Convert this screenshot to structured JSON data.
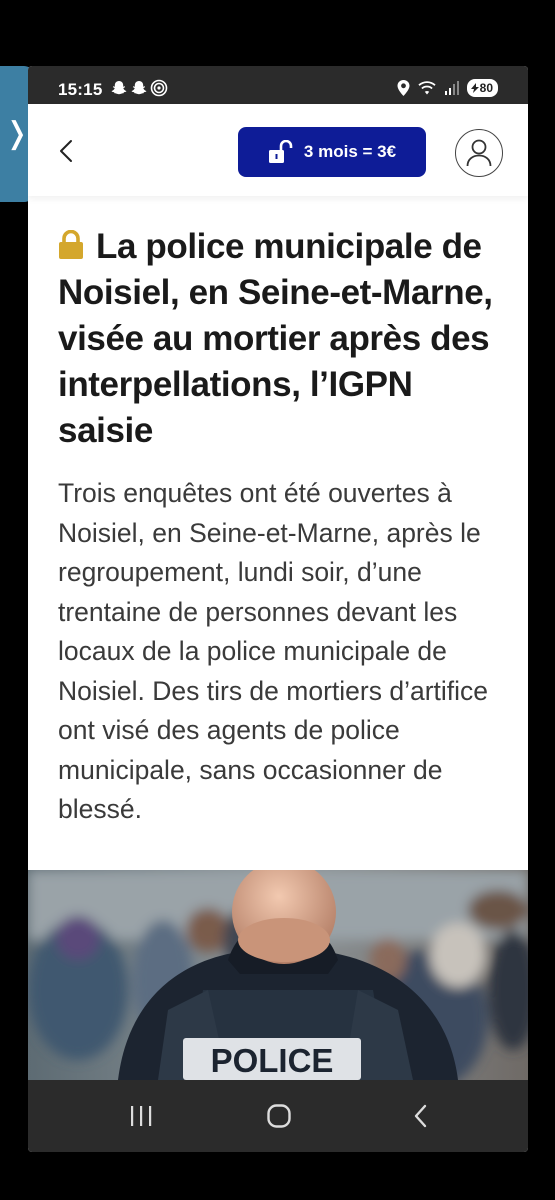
{
  "status_bar": {
    "time": "15:15",
    "notification_icons": [
      "snapchat-icon",
      "snapchat-icon",
      "signal-wifi-icon"
    ],
    "right_icons": [
      "location-icon",
      "wifi-icon",
      "signal-icon"
    ],
    "battery": "80"
  },
  "app_bar": {
    "back_icon": "chevron-left-icon",
    "offer_label": "3 mois = 3€",
    "offer_icon": "unlock-icon",
    "account_icon": "user-icon"
  },
  "article": {
    "premium_icon": "lock-icon",
    "title": "La police municipale de Noisiel, en Seine-et-Marne, visée au mortier après des interpellations, l’IGPN saisie",
    "lead": "Trois enquêtes ont été ouvertes à Noisiel, en Seine-et-Marne, après le regroupement, lundi soir, d’une trentaine de personnes devant les locaux de la police municipale de Noisiel. Des tirs de mortiers d’artifice ont visé des agents de police municipale, sans occasionner de blessé.",
    "photo_text": "POLICE"
  },
  "colors": {
    "offer_bg": "#0e1c97",
    "lock_gold": "#d4a72c",
    "side_tab": "#3d7fa3",
    "system_bar": "#2b2b2b"
  },
  "nav_bar": {
    "icons": [
      "recent-apps-icon",
      "home-icon",
      "back-icon"
    ]
  }
}
